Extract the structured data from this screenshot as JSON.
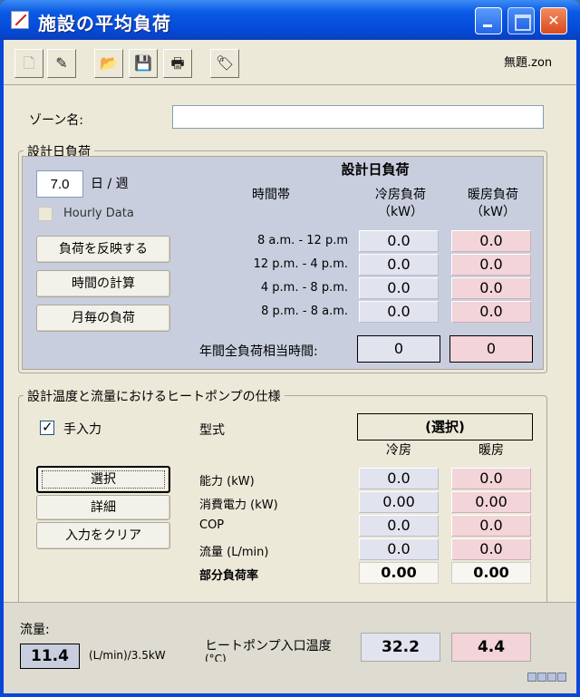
{
  "window": {
    "title": "施設の平均負荷"
  },
  "toolbar": {
    "filename": "無題.zon"
  },
  "zone": {
    "label": "ゾーン名:",
    "value": ""
  },
  "design_load": {
    "group_title": "設計日負荷",
    "days_per_week": "7.0",
    "days_unit": "日 / 週",
    "hourly_label": "Hourly Data",
    "buttons": {
      "reflect": "負荷を反映する",
      "calc_hours": "時間の計算",
      "monthly": "月毎の負荷"
    },
    "table_title": "設計日負荷",
    "col_time": "時間帯",
    "col_cool": "冷房負荷",
    "col_heat": "暖房負荷",
    "unit": "（kW）",
    "rows": [
      {
        "time": "8 a.m. - 12 p.m",
        "cool": "0.0",
        "heat": "0.0"
      },
      {
        "time": "12 p.m. - 4 p.m.",
        "cool": "0.0",
        "heat": "0.0"
      },
      {
        "time": "4 p.m. - 8 p.m.",
        "cool": "0.0",
        "heat": "0.0"
      },
      {
        "time": "8 p.m. - 8 a.m.",
        "cool": "0.0",
        "heat": "0.0"
      }
    ],
    "annual_label": "年間全負荷相当時間:",
    "annual_cool": "0",
    "annual_heat": "0"
  },
  "heatpump": {
    "group_title": "設計温度と流量におけるヒートポンプの仕様",
    "manual_label": "手入力",
    "manual_checked": true,
    "buttons": {
      "select": "選択",
      "details": "詳細",
      "clear": "入力をクリア"
    },
    "model_label": "型式",
    "model_value": "(選択)",
    "col_cool": "冷房",
    "col_heat": "暖房",
    "rows": [
      {
        "label": "能力 (kW)",
        "cool": "0.0",
        "heat": "0.0"
      },
      {
        "label": "消費電力 (kW)",
        "cool": "0.00",
        "heat": "0.00"
      },
      {
        "label": "COP",
        "cool": "0.0",
        "heat": "0.0"
      },
      {
        "label": "流量 (L/min)",
        "cool": "0.0",
        "heat": "0.0"
      },
      {
        "label": "部分負荷率",
        "cool": "0.00",
        "heat": "0.00"
      }
    ]
  },
  "bottom": {
    "flow_label": "流量:",
    "flow_value": "11.4",
    "flow_unit": "(L/min)/3.5kW",
    "inlet_label": "ヒートポンプ入口温度",
    "inlet_unit": "(°C)",
    "inlet_cool": "32.2",
    "inlet_heat": "4.4"
  }
}
